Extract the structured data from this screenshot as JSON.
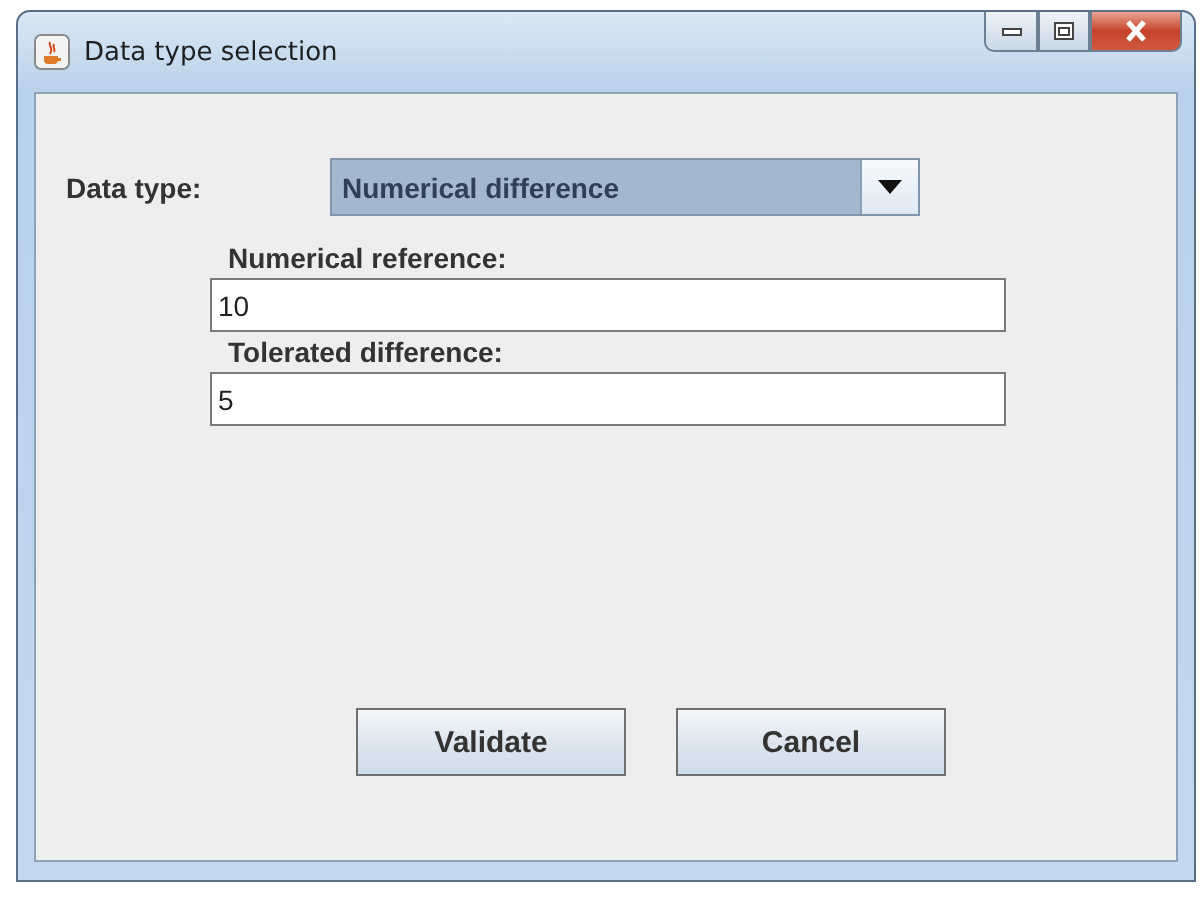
{
  "window": {
    "title": "Data type selection"
  },
  "data_type": {
    "label": "Data type:",
    "value": "Numerical difference"
  },
  "fields": [
    {
      "label": "Numerical reference:",
      "value": "10"
    },
    {
      "label": "Tolerated difference:",
      "value": "5"
    }
  ],
  "buttons": [
    "Validate",
    "Cancel"
  ]
}
